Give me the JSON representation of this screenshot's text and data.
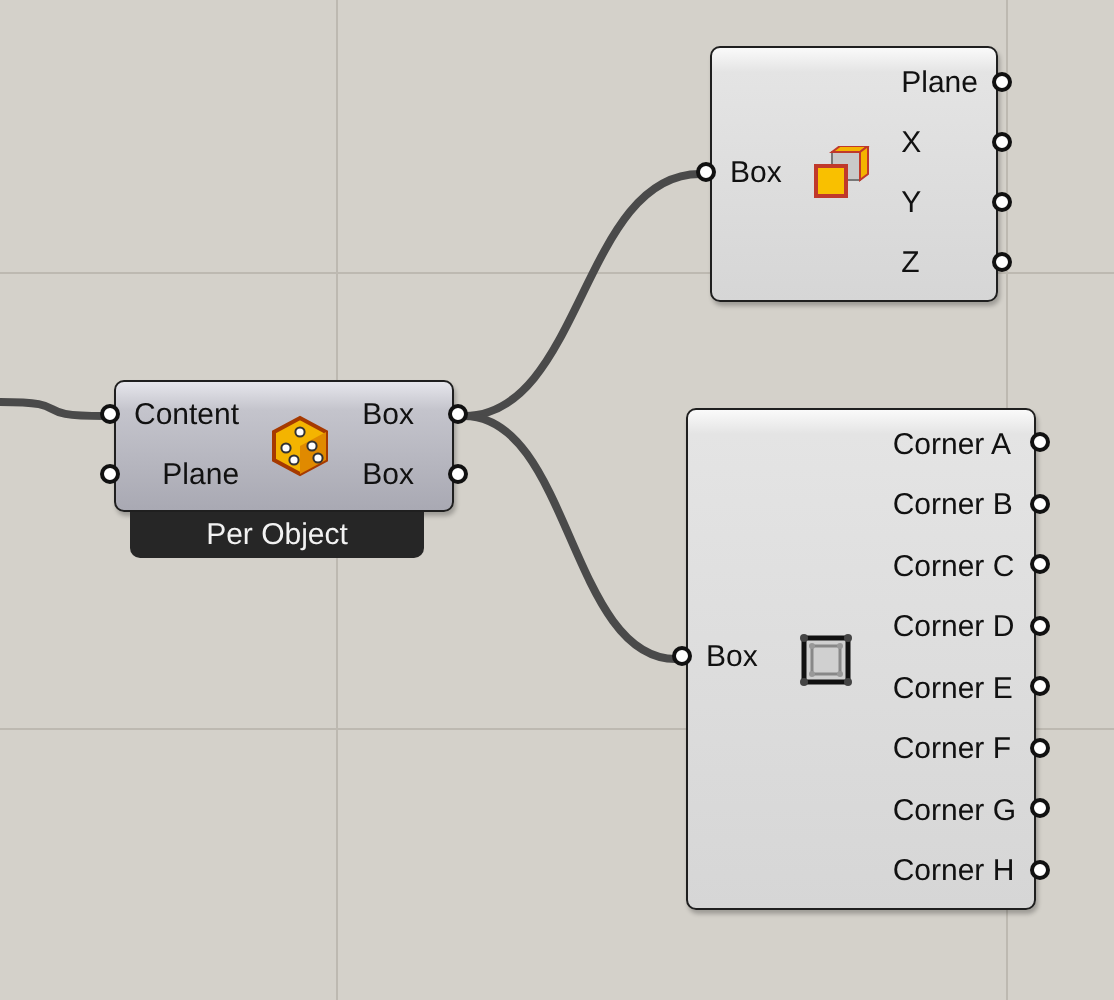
{
  "canvas": {
    "nodes": [
      {
        "kind": "dice",
        "inputs": [
          {
            "label": "Content"
          },
          {
            "label": "Plane"
          }
        ],
        "outputs": [
          {
            "label": "Box"
          },
          {
            "label": "Box"
          }
        ],
        "footer": "Per Object"
      },
      {
        "kind": "deconstruct",
        "inputs": [
          {
            "label": "Box"
          }
        ],
        "outputs": [
          {
            "label": "Plane"
          },
          {
            "label": "X"
          },
          {
            "label": "Y"
          },
          {
            "label": "Z"
          }
        ]
      },
      {
        "kind": "corners",
        "inputs": [
          {
            "label": "Box"
          }
        ],
        "outputs": [
          {
            "label": "Corner A"
          },
          {
            "label": "Corner B"
          },
          {
            "label": "Corner C"
          },
          {
            "label": "Corner D"
          },
          {
            "label": "Corner E"
          },
          {
            "label": "Corner F"
          },
          {
            "label": "Corner G"
          },
          {
            "label": "Corner H"
          }
        ]
      }
    ]
  }
}
